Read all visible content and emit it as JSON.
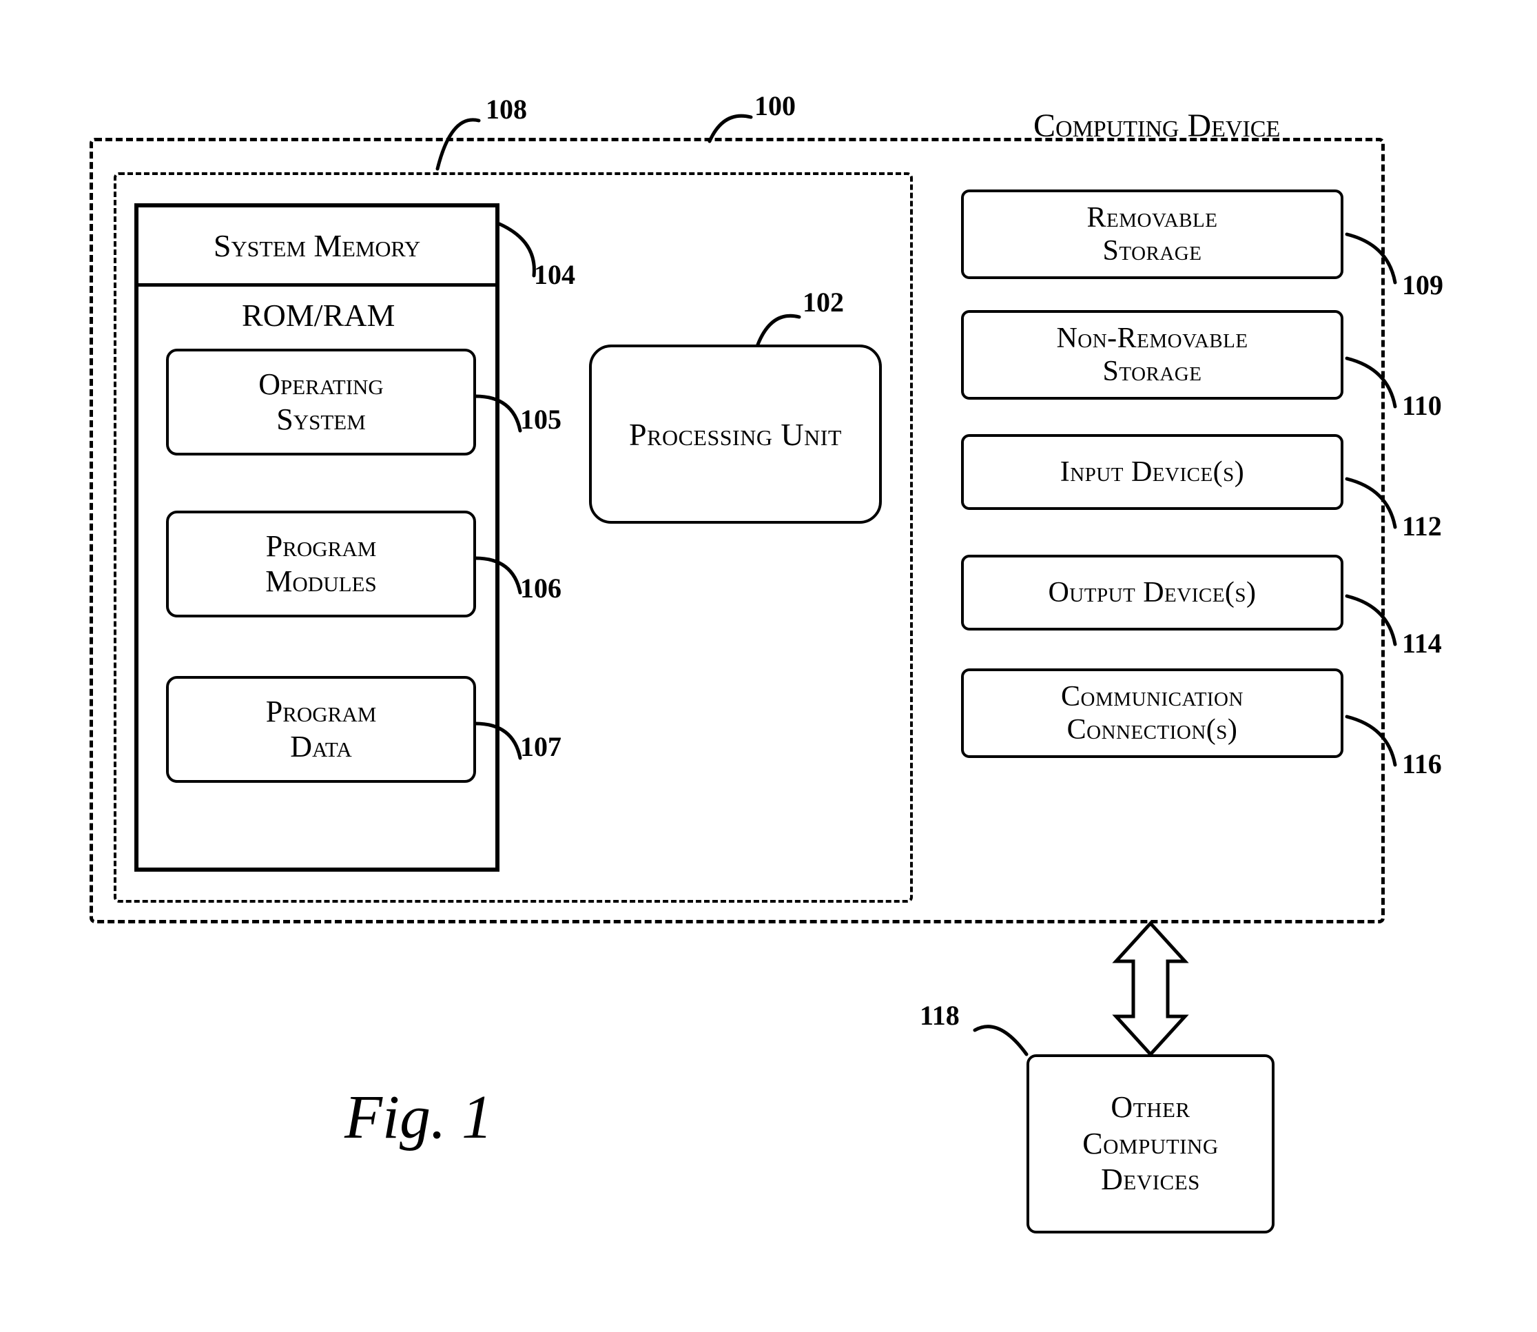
{
  "title": "Computing Device",
  "figure_caption": "Fig. 1",
  "refs": {
    "computing_device": "100",
    "processing_unit": "102",
    "system_memory": "104",
    "operating_system": "105",
    "program_modules": "106",
    "program_data": "107",
    "inner_dashed": "108",
    "removable_storage": "109",
    "non_removable_storage": "110",
    "input_devices": "112",
    "output_devices": "114",
    "communication_connections": "116",
    "other_devices": "118"
  },
  "blocks": {
    "system_memory_title": "System Memory",
    "rom_ram": "ROM/RAM",
    "operating_system": "Operating\nSystem",
    "program_modules": "Program\nModules",
    "program_data": "Program\nData",
    "processing_unit": "Processing Unit",
    "removable_storage": "Removable\nStorage",
    "non_removable_storage": "Non-Removable\nStorage",
    "input_devices": "Input Device(s)",
    "output_devices": "Output Device(s)",
    "communication_connections": "Communication\nConnection(s)",
    "other_devices": "Other\nComputing\nDevices"
  }
}
